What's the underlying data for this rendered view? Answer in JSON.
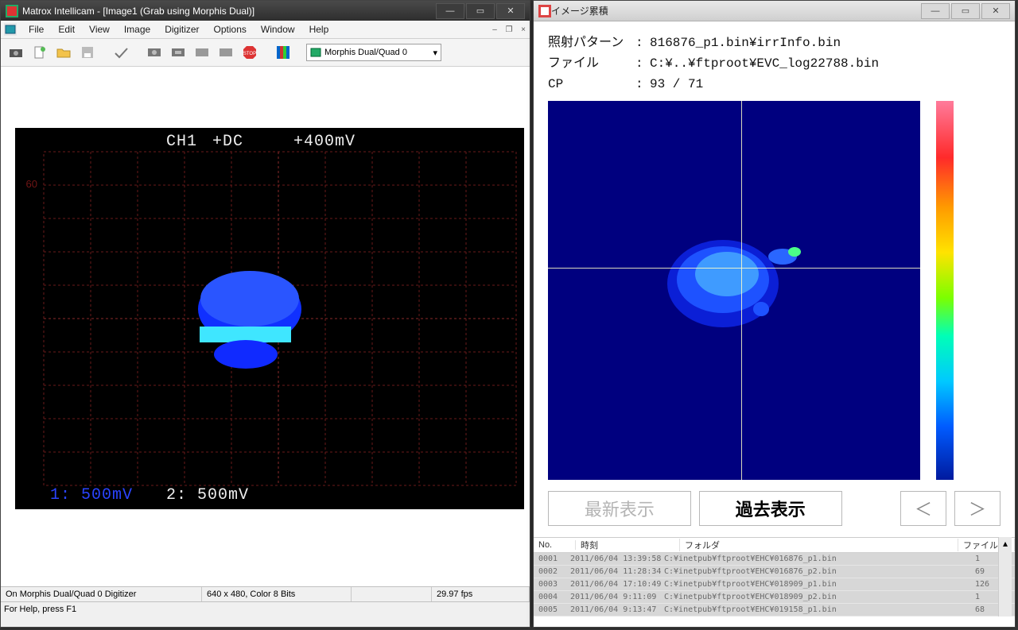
{
  "left": {
    "title": "Matrox Intellicam - [Image1 (Grab using Morphis Dual)]",
    "menu": [
      "File",
      "Edit",
      "View",
      "Image",
      "Digitizer",
      "Options",
      "Window",
      "Help"
    ],
    "combo": "Morphis Dual/Quad 0",
    "scope": {
      "ch": "CH1",
      "mode": "+DC",
      "range": "+400mV",
      "ch1_div": "1: 500mV",
      "ch2_div": "2: 500mV"
    },
    "status": {
      "digitizer": "On Morphis Dual/Quad 0 Digitizer",
      "size": "640 x 480, Color 8 Bits",
      "fps": "29.97 fps",
      "help": "For Help, press F1"
    }
  },
  "right": {
    "title": "イメージ累積",
    "info": {
      "pattern_k": "照射パターン",
      "pattern_v": "816876_p1.bin¥irrInfo.bin",
      "file_k": "ファイル",
      "file_v": "C:¥..¥ftproot¥EVC_log22788.bin",
      "cp_k": "CP",
      "cp_v": "93 / 71"
    },
    "buttons": {
      "latest": "最新表示",
      "past": "過去表示",
      "prev": "＜",
      "next": "＞"
    },
    "list": {
      "headers": {
        "no": "No.",
        "time": "時刻",
        "folder": "フォルダ",
        "count": "ファイル数"
      },
      "rows": [
        {
          "no": "0001",
          "time": "2011/06/04 13:39:58",
          "folder": "C:¥inetpub¥ftproot¥EHC¥016876_p1.bin",
          "count": "1"
        },
        {
          "no": "0002",
          "time": "2011/06/04 11:28:34",
          "folder": "C:¥inetpub¥ftproot¥EHC¥016876_p2.bin",
          "count": "69"
        },
        {
          "no": "0003",
          "time": "2011/06/04 17:10:49",
          "folder": "C:¥inetpub¥ftproot¥EHC¥018909_p1.bin",
          "count": "126"
        },
        {
          "no": "0004",
          "time": "2011/06/04 9:11:09",
          "folder": "C:¥inetpub¥ftproot¥EHC¥018909_p2.bin",
          "count": "1"
        },
        {
          "no": "0005",
          "time": "2011/06/04 9:13:47",
          "folder": "C:¥inetpub¥ftproot¥EHC¥019158_p1.bin",
          "count": "68"
        }
      ]
    }
  }
}
